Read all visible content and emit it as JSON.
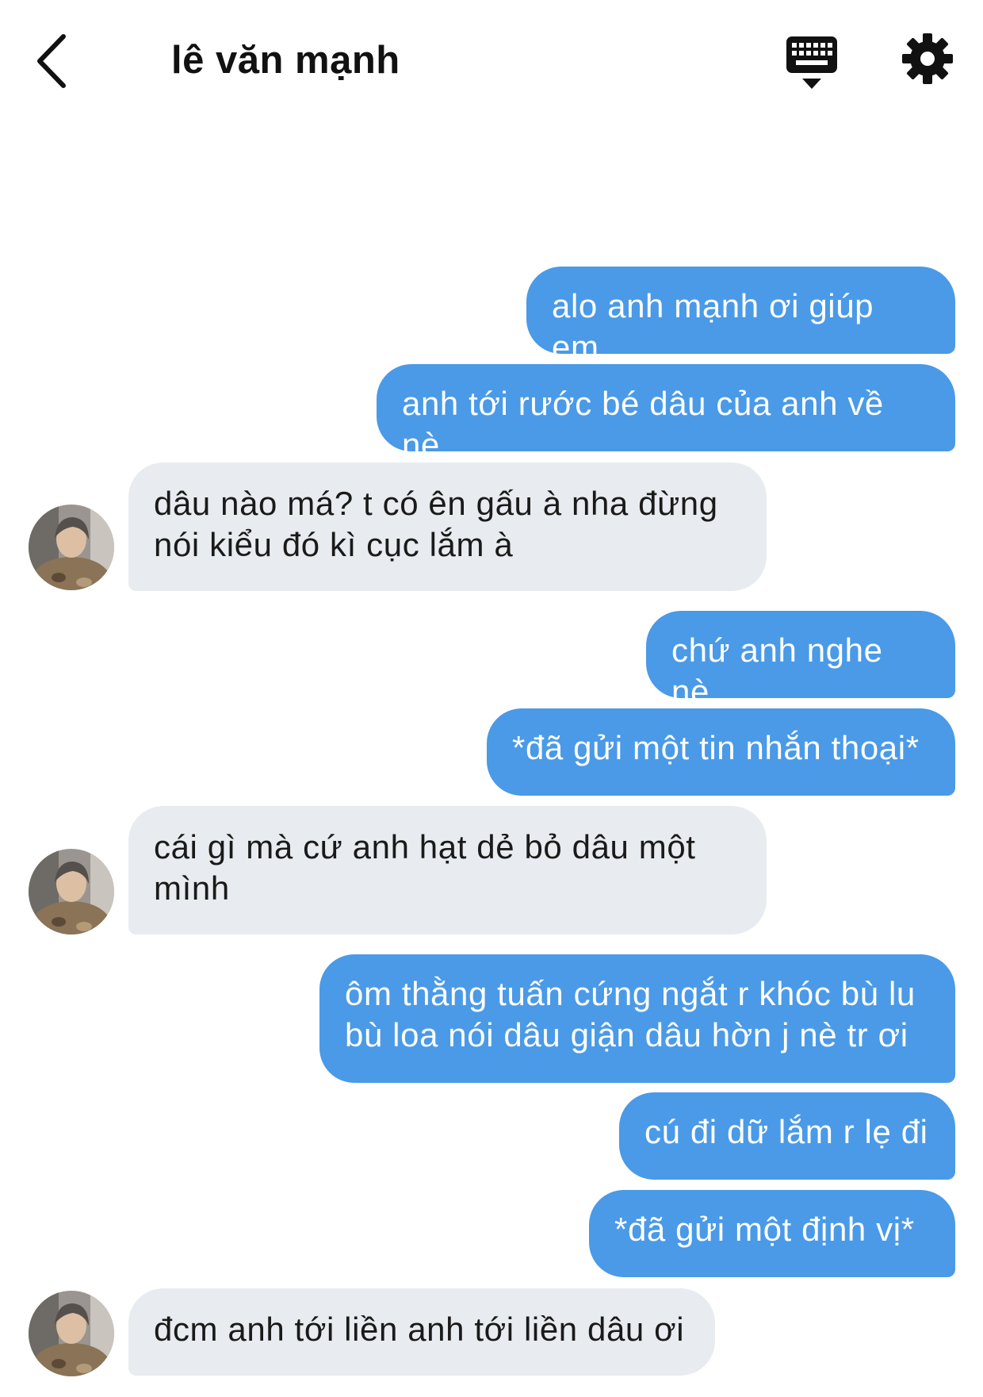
{
  "header": {
    "title": "lê văn mạnh",
    "back_icon": "chevron-left-icon",
    "keyboard_icon": "keyboard-icon",
    "settings_icon": "gear-icon"
  },
  "colors": {
    "outgoing_bubble": "#4a9ae7",
    "incoming_bubble": "#e8ebef"
  },
  "messages": [
    {
      "from": "me",
      "text": "alo anh mạnh ơi giúp em"
    },
    {
      "from": "me",
      "text": "anh tới rước bé dâu của anh về nè"
    },
    {
      "from": "them",
      "text": "dâu nào má? t có ên gấu à nha đừng\nnói kiểu đó kì cục lắm à"
    },
    {
      "from": "me",
      "text": "chứ anh nghe nè"
    },
    {
      "from": "me",
      "text": "*đã gửi một tin nhắn thoại*"
    },
    {
      "from": "them",
      "text": "cái gì mà cứ anh hạt dẻ bỏ dâu một\nmình"
    },
    {
      "from": "me",
      "text": "ôm thằng tuấn cứng ngắt r khóc bù lu\nbù loa nói dâu giận dâu hờn j nè tr ơi"
    },
    {
      "from": "me",
      "text": "cú đi dữ lắm r lẹ đi"
    },
    {
      "from": "me",
      "text": "*đã gửi một định vị*"
    },
    {
      "from": "them",
      "text": "đcm anh tới liền anh tới liền dâu ơi"
    }
  ]
}
